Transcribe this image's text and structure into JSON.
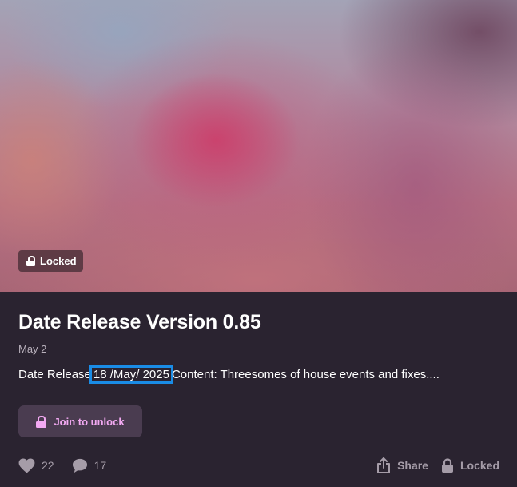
{
  "hero": {
    "badge_label": "Locked",
    "badge_icon": "lock-icon"
  },
  "post": {
    "title": "Date Release Version 0.85",
    "date": "May 2",
    "teaser_prefix": "Date Release",
    "teaser_highlight": "18 /May/ 2025",
    "teaser_suffix": "Content: Threesomes of house events and fixes....",
    "highlight_color": "#1a8ce6"
  },
  "actions": {
    "join_label": "Join to unlock",
    "join_color": "#f2a9f2"
  },
  "footer": {
    "likes_count": "22",
    "comments_count": "17",
    "share_label": "Share",
    "locked_label": "Locked"
  },
  "icons": {
    "like": "heart-icon",
    "comment": "comment-icon",
    "share": "share-icon",
    "lock": "lock-icon"
  }
}
